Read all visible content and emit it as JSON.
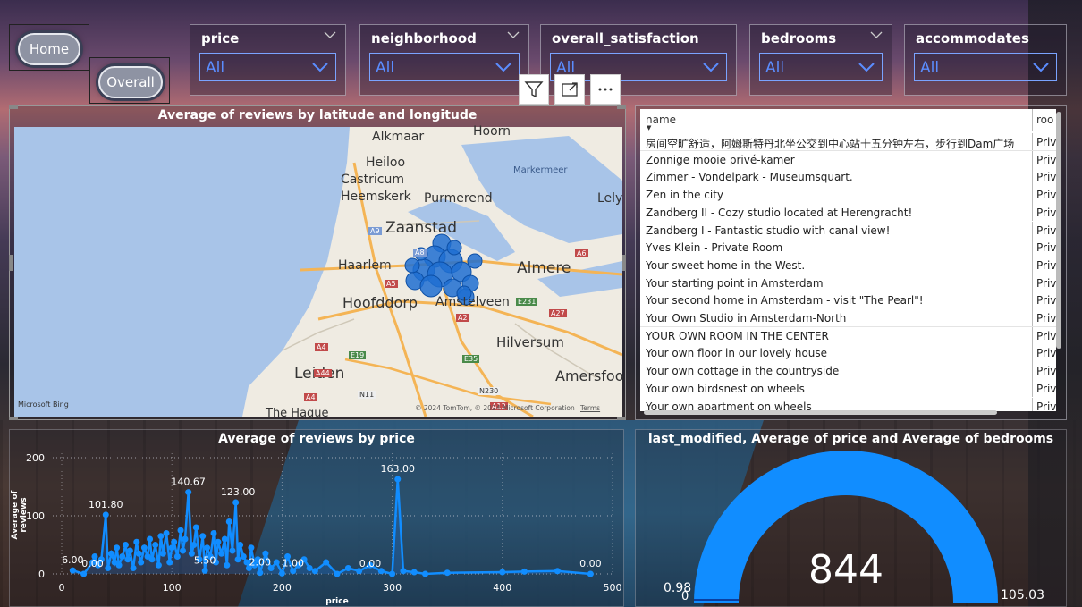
{
  "nav": {
    "home_label": "Home",
    "overall_label": "Overall"
  },
  "slicers": [
    {
      "title": "price",
      "value": "All"
    },
    {
      "title": "neighborhood",
      "value": "All"
    },
    {
      "title": "overall_satisfaction",
      "value": "All"
    },
    {
      "title": "bedrooms",
      "value": "All"
    },
    {
      "title": "accommodates",
      "value": "All"
    }
  ],
  "toolbar": {
    "filter_icon": "filter-icon",
    "focus_icon": "focus-mode-icon",
    "more_icon": "more-options-icon"
  },
  "map_visual": {
    "title": "Average of reviews by latitude and longitude",
    "places": [
      "Alkmaar",
      "Hoorn",
      "Heiloo",
      "Markermeer",
      "Castricum",
      "Heemskerk",
      "Purmerend",
      "Lely",
      "Zaanstad",
      "Haarlem",
      "Almere",
      "Hoofddorp",
      "Amstelveen",
      "Hilversum",
      "Leiden",
      "Amersfoo",
      "The Hague"
    ],
    "road_labels": [
      "A9",
      "A8",
      "A5",
      "A6",
      "A4",
      "A2",
      "E231",
      "A27",
      "A44",
      "E19",
      "E35",
      "N11",
      "A4",
      "N230",
      "A12"
    ],
    "brand": "Microsoft Bing",
    "copyright": "© 2024 TomTom, © 2024 Microsoft Corporation",
    "terms": "Terms"
  },
  "table_visual": {
    "columns": [
      "name",
      "roo"
    ],
    "rows": [
      [
        "房间空旷舒适，阿姆斯特丹北坐公交到中心站十五分钟左右，步行到Dam广场",
        "Priv"
      ],
      [
        "Zonnige mooie privé-kamer",
        "Priv"
      ],
      [
        "Zimmer - Vondelpark - Museumsquart.",
        "Priv"
      ],
      [
        "Zen in the city",
        "Priv"
      ],
      [
        "Zandberg II - Cozy studio located at Herengracht!",
        "Priv"
      ],
      [
        "Zandberg I - Fantastic studio with canal view!",
        "Priv"
      ],
      [
        "Yves Klein - Private Room",
        "Priv"
      ],
      [
        "Your sweet home in the West.",
        "Priv"
      ],
      [
        "Your starting point in Amsterdam",
        "Priv"
      ],
      [
        "Your second home in Amsterdam - visit \"The Pearl\"!",
        "Priv"
      ],
      [
        "Your Own Studio in Amsterdam-North",
        "Priv"
      ],
      [
        "YOUR OWN ROOM IN THE CENTER",
        "Priv"
      ],
      [
        "Your own floor in our lovely house",
        "Priv"
      ],
      [
        "Your own cottage in the countryside",
        "Priv"
      ],
      [
        "Your own birdsnest on wheels",
        "Priv"
      ],
      [
        "Your own apartment on wheels",
        "Priv"
      ]
    ]
  },
  "price_chart": {
    "title": "Average of reviews by price",
    "xlabel": "price",
    "ylabel": "Average of reviews"
  },
  "gauge_visual": {
    "title": "last_modified, Average of price and Average of bedrooms",
    "value": "844",
    "min_label": "0.98",
    "min_zero": "0",
    "max_label": "105.03",
    "color": "#118dff"
  },
  "chart_data": {
    "type": "line",
    "title": "Average of reviews by price",
    "xlabel": "price",
    "ylabel": "Average of reviews",
    "xlim": [
      0,
      500
    ],
    "ylim": [
      0,
      200
    ],
    "xticks": [
      0,
      100,
      200,
      300,
      400,
      500
    ],
    "yticks": [
      0,
      100,
      200
    ],
    "color": "#118dff",
    "x": [
      10,
      20,
      28,
      30,
      33,
      36,
      40,
      42,
      45,
      48,
      50,
      52,
      55,
      58,
      60,
      62,
      65,
      68,
      70,
      72,
      75,
      78,
      80,
      82,
      85,
      88,
      90,
      92,
      95,
      98,
      100,
      102,
      105,
      108,
      110,
      112,
      115,
      118,
      120,
      122,
      125,
      128,
      130,
      132,
      135,
      138,
      140,
      142,
      145,
      148,
      150,
      152,
      155,
      158,
      160,
      162,
      165,
      168,
      170,
      172,
      175,
      178,
      180,
      185,
      190,
      195,
      200,
      205,
      210,
      215,
      220,
      225,
      230,
      240,
      250,
      260,
      270,
      280,
      290,
      300,
      305,
      310,
      320,
      330,
      350,
      400,
      420,
      450,
      480
    ],
    "y": [
      6,
      0,
      20,
      30,
      15,
      25,
      101.8,
      10,
      35,
      20,
      45,
      15,
      30,
      50,
      25,
      40,
      10,
      55,
      35,
      20,
      45,
      30,
      60,
      25,
      50,
      15,
      65,
      35,
      70,
      20,
      45,
      55,
      30,
      75,
      40,
      60,
      140.67,
      35,
      50,
      80,
      25,
      65,
      5.5,
      45,
      30,
      70,
      20,
      55,
      35,
      60,
      15,
      90,
      40,
      123,
      25,
      50,
      30,
      20,
      10,
      45,
      15,
      25,
      2,
      35,
      10,
      20,
      1,
      30,
      5,
      15,
      25,
      10,
      5,
      20,
      0,
      10,
      5,
      15,
      5,
      0,
      163,
      5,
      3,
      0,
      2,
      3,
      4,
      5,
      0
    ],
    "labels": [
      {
        "x": 10,
        "y": 6,
        "text": "6.00"
      },
      {
        "x": 28,
        "y": 0,
        "text": "0.00"
      },
      {
        "x": 40,
        "y": 101.8,
        "text": "101.80"
      },
      {
        "x": 115,
        "y": 140.67,
        "text": "140.67"
      },
      {
        "x": 130,
        "y": 5.5,
        "text": "5.50"
      },
      {
        "x": 160,
        "y": 123,
        "text": "123.00"
      },
      {
        "x": 180,
        "y": 2,
        "text": "2.00"
      },
      {
        "x": 210,
        "y": 1,
        "text": "1.00"
      },
      {
        "x": 280,
        "y": 0,
        "text": "0.00"
      },
      {
        "x": 305,
        "y": 163,
        "text": "163.00"
      },
      {
        "x": 480,
        "y": 0,
        "text": "0.00"
      }
    ]
  }
}
